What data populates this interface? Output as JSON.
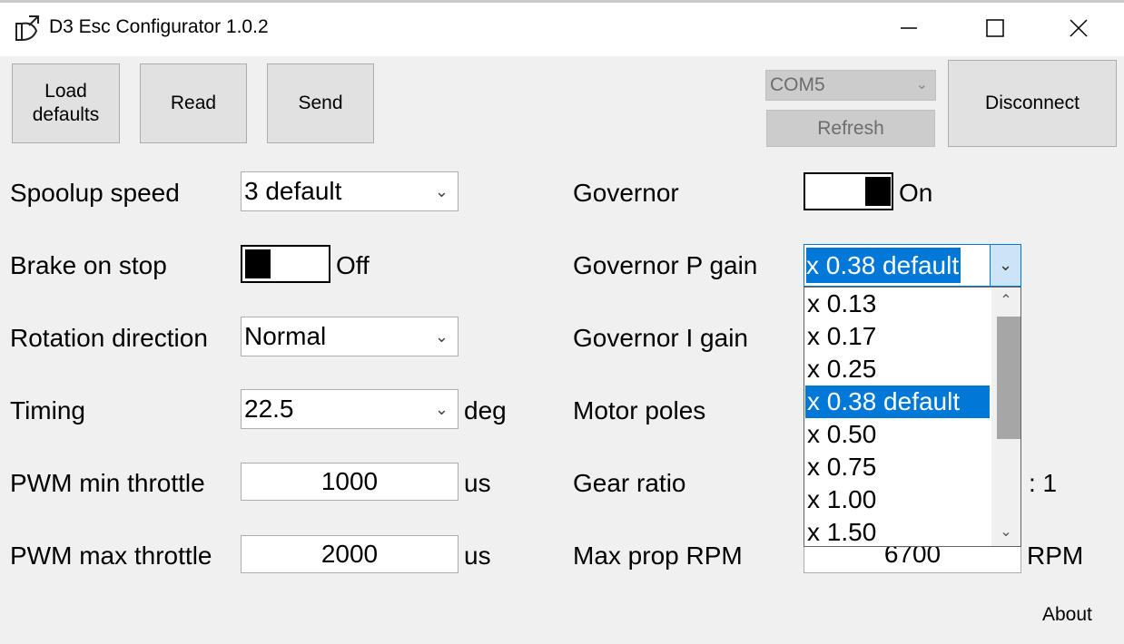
{
  "window": {
    "title": "D3 Esc Configurator 1.0.2",
    "minimize_icon": "minimize-icon",
    "maximize_icon": "maximize-icon",
    "close_icon": "close-icon"
  },
  "toolbar": {
    "load_defaults_label": "Load\ndefaults",
    "read_label": "Read",
    "send_label": "Send",
    "port_value": "COM5",
    "refresh_label": "Refresh",
    "disconnect_label": "Disconnect"
  },
  "left": {
    "spoolup_label": "Spoolup speed",
    "spoolup_value": "3 default",
    "brake_label": "Brake on stop",
    "brake_state": "Off",
    "rotation_label": "Rotation direction",
    "rotation_value": "Normal",
    "timing_label": "Timing",
    "timing_value": "22.5",
    "timing_unit": "deg",
    "pwm_min_label": "PWM min throttle",
    "pwm_min_value": "1000",
    "pwm_min_unit": "us",
    "pwm_max_label": "PWM max throttle",
    "pwm_max_value": "2000",
    "pwm_max_unit": "us"
  },
  "right": {
    "governor_label": "Governor",
    "governor_state": "On",
    "p_gain_label": "Governor P gain",
    "p_gain_value": "x 0.38 default",
    "i_gain_label": "Governor I gain",
    "motor_poles_label": "Motor poles",
    "gear_ratio_label": "Gear ratio",
    "gear_ratio_suffix": ": 1",
    "max_rpm_label": "Max prop RPM",
    "max_rpm_value": "6700",
    "max_rpm_unit": "RPM"
  },
  "p_gain_dropdown": {
    "options": [
      "x 0.13",
      "x 0.17",
      "x 0.25",
      "x 0.38 default",
      "x 0.50",
      "x 0.75",
      "x 1.00",
      "x 1.50"
    ],
    "selected_index": 3
  },
  "footer": {
    "about_label": "About"
  },
  "colors": {
    "accent": "#0078d7",
    "background": "#f0f0f0"
  }
}
